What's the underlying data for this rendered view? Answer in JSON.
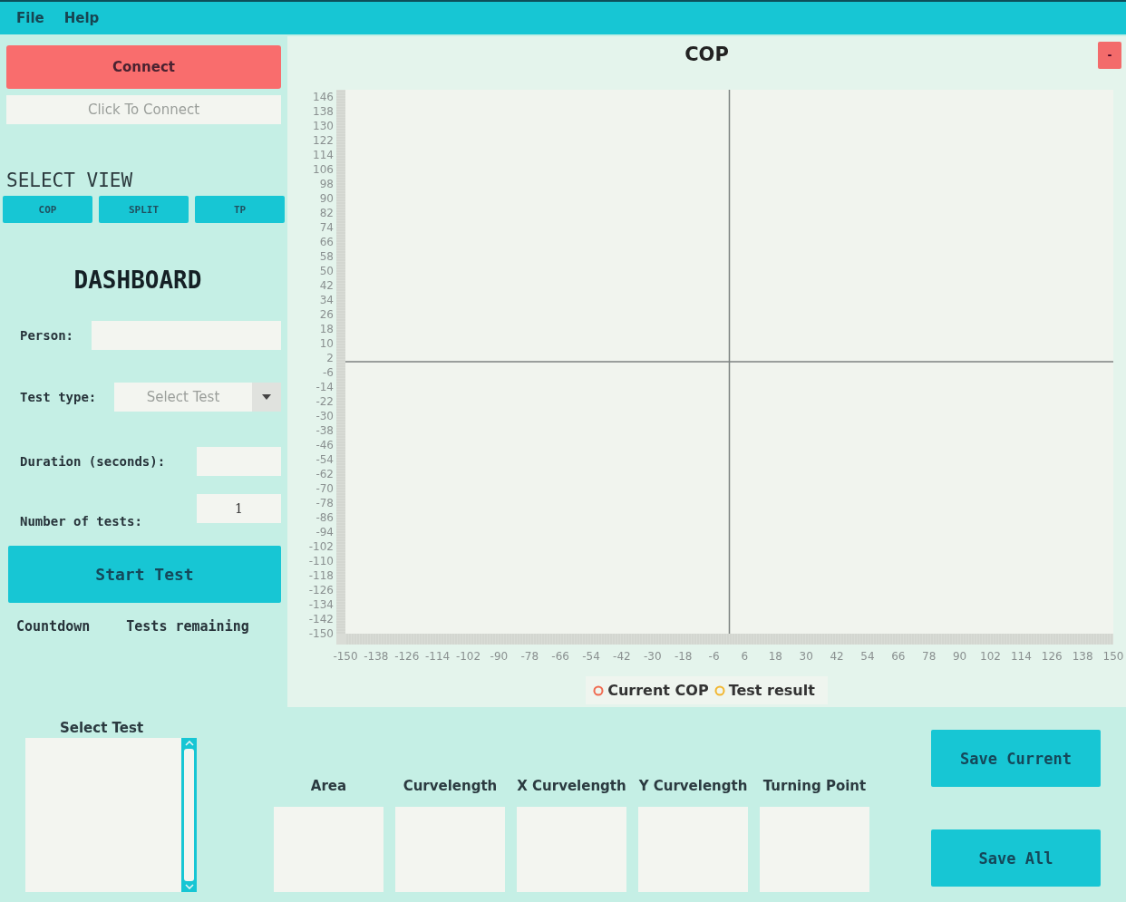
{
  "menu": [
    {
      "label": "File"
    },
    {
      "label": "Help"
    }
  ],
  "connection": {
    "button": "Connect",
    "status": {
      "placeholder": "Click To Connect"
    }
  },
  "select_view": {
    "title": "SELECT VIEW",
    "buttons": [
      {
        "label": "COP"
      },
      {
        "label": "SPLIT"
      },
      {
        "label": "TP"
      }
    ]
  },
  "dashboard": {
    "title": "DASHBOARD",
    "fields": [
      {
        "kind": "text",
        "label": "Person:"
      },
      {
        "kind": "combo",
        "label": "Test type:",
        "placeholder": "Select Test"
      },
      {
        "kind": "text",
        "label": "Duration (seconds):"
      },
      {
        "kind": "text",
        "label": "Number of tests:",
        "value": "1"
      }
    ],
    "start_button": "Start Test",
    "countdown": "Countdown",
    "tests_remaining": "Tests remaining"
  },
  "chart": {
    "collapse_button": "-",
    "chart_data": {
      "type": "scatter",
      "title": "COP",
      "series": [
        {
          "name": "Current COP",
          "color": "#f06a50",
          "values": [
            null,
            null,
            null,
            null,
            null,
            null,
            null,
            null,
            null,
            null,
            null,
            null,
            null,
            null,
            null,
            null,
            null,
            null,
            null,
            null,
            null,
            null,
            null,
            null,
            null,
            null
          ]
        },
        {
          "name": "Test result",
          "color": "#f2b630",
          "values": [
            null,
            null,
            null,
            null,
            null,
            null,
            null,
            null,
            null,
            null,
            null,
            null,
            null,
            null,
            null,
            null,
            null,
            null,
            null,
            null,
            null,
            null,
            null,
            null,
            null,
            null
          ]
        }
      ],
      "ylim": [
        -150,
        150
      ],
      "categories": [
        "-150",
        "-138",
        "-126",
        "-114",
        "-102",
        "-90",
        "-78",
        "-66",
        "-54",
        "-42",
        "-30",
        "-18",
        "-6",
        "6",
        "18",
        "30",
        "42",
        "54",
        "66",
        "78",
        "90",
        "102",
        "114",
        "126",
        "138",
        "150"
      ],
      "yticks": [
        146,
        138,
        130,
        122,
        114,
        106,
        98,
        90,
        82,
        74,
        66,
        58,
        50,
        42,
        34,
        26,
        18,
        10,
        2,
        -6,
        -14,
        -22,
        -30,
        -38,
        -46,
        -54,
        -62,
        -70,
        -78,
        -86,
        -94,
        -102,
        -110,
        -118,
        -126,
        -134,
        -142,
        -150
      ]
    }
  },
  "select_test": {
    "title": "Select Test"
  },
  "metrics": [
    {
      "label": "Area"
    },
    {
      "label": "Curvelength"
    },
    {
      "label": "X Curvelength"
    },
    {
      "label": "Y Curvelength"
    },
    {
      "label": "Turning Point"
    }
  ],
  "save_buttons": [
    {
      "label": "Save Current"
    },
    {
      "label": "Save All"
    }
  ]
}
